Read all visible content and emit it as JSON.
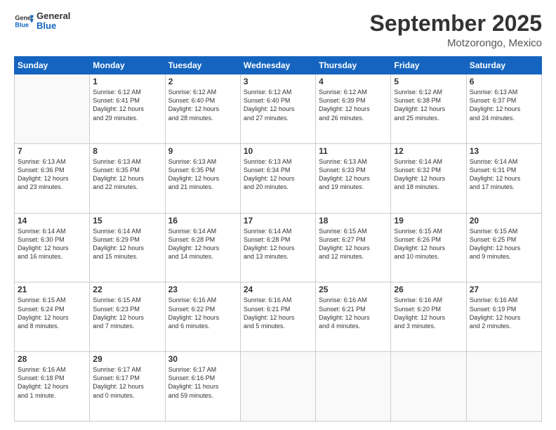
{
  "header": {
    "logo_general": "General",
    "logo_blue": "Blue",
    "month_title": "September 2025",
    "location": "Motzorongo, Mexico"
  },
  "days_of_week": [
    "Sunday",
    "Monday",
    "Tuesday",
    "Wednesday",
    "Thursday",
    "Friday",
    "Saturday"
  ],
  "weeks": [
    [
      {
        "day": "",
        "info": ""
      },
      {
        "day": "1",
        "info": "Sunrise: 6:12 AM\nSunset: 6:41 PM\nDaylight: 12 hours\nand 29 minutes."
      },
      {
        "day": "2",
        "info": "Sunrise: 6:12 AM\nSunset: 6:40 PM\nDaylight: 12 hours\nand 28 minutes."
      },
      {
        "day": "3",
        "info": "Sunrise: 6:12 AM\nSunset: 6:40 PM\nDaylight: 12 hours\nand 27 minutes."
      },
      {
        "day": "4",
        "info": "Sunrise: 6:12 AM\nSunset: 6:39 PM\nDaylight: 12 hours\nand 26 minutes."
      },
      {
        "day": "5",
        "info": "Sunrise: 6:12 AM\nSunset: 6:38 PM\nDaylight: 12 hours\nand 25 minutes."
      },
      {
        "day": "6",
        "info": "Sunrise: 6:13 AM\nSunset: 6:37 PM\nDaylight: 12 hours\nand 24 minutes."
      }
    ],
    [
      {
        "day": "7",
        "info": "Sunrise: 6:13 AM\nSunset: 6:36 PM\nDaylight: 12 hours\nand 23 minutes."
      },
      {
        "day": "8",
        "info": "Sunrise: 6:13 AM\nSunset: 6:35 PM\nDaylight: 12 hours\nand 22 minutes."
      },
      {
        "day": "9",
        "info": "Sunrise: 6:13 AM\nSunset: 6:35 PM\nDaylight: 12 hours\nand 21 minutes."
      },
      {
        "day": "10",
        "info": "Sunrise: 6:13 AM\nSunset: 6:34 PM\nDaylight: 12 hours\nand 20 minutes."
      },
      {
        "day": "11",
        "info": "Sunrise: 6:13 AM\nSunset: 6:33 PM\nDaylight: 12 hours\nand 19 minutes."
      },
      {
        "day": "12",
        "info": "Sunrise: 6:14 AM\nSunset: 6:32 PM\nDaylight: 12 hours\nand 18 minutes."
      },
      {
        "day": "13",
        "info": "Sunrise: 6:14 AM\nSunset: 6:31 PM\nDaylight: 12 hours\nand 17 minutes."
      }
    ],
    [
      {
        "day": "14",
        "info": "Sunrise: 6:14 AM\nSunset: 6:30 PM\nDaylight: 12 hours\nand 16 minutes."
      },
      {
        "day": "15",
        "info": "Sunrise: 6:14 AM\nSunset: 6:29 PM\nDaylight: 12 hours\nand 15 minutes."
      },
      {
        "day": "16",
        "info": "Sunrise: 6:14 AM\nSunset: 6:28 PM\nDaylight: 12 hours\nand 14 minutes."
      },
      {
        "day": "17",
        "info": "Sunrise: 6:14 AM\nSunset: 6:28 PM\nDaylight: 12 hours\nand 13 minutes."
      },
      {
        "day": "18",
        "info": "Sunrise: 6:15 AM\nSunset: 6:27 PM\nDaylight: 12 hours\nand 12 minutes."
      },
      {
        "day": "19",
        "info": "Sunrise: 6:15 AM\nSunset: 6:26 PM\nDaylight: 12 hours\nand 10 minutes."
      },
      {
        "day": "20",
        "info": "Sunrise: 6:15 AM\nSunset: 6:25 PM\nDaylight: 12 hours\nand 9 minutes."
      }
    ],
    [
      {
        "day": "21",
        "info": "Sunrise: 6:15 AM\nSunset: 6:24 PM\nDaylight: 12 hours\nand 8 minutes."
      },
      {
        "day": "22",
        "info": "Sunrise: 6:15 AM\nSunset: 6:23 PM\nDaylight: 12 hours\nand 7 minutes."
      },
      {
        "day": "23",
        "info": "Sunrise: 6:16 AM\nSunset: 6:22 PM\nDaylight: 12 hours\nand 6 minutes."
      },
      {
        "day": "24",
        "info": "Sunrise: 6:16 AM\nSunset: 6:21 PM\nDaylight: 12 hours\nand 5 minutes."
      },
      {
        "day": "25",
        "info": "Sunrise: 6:16 AM\nSunset: 6:21 PM\nDaylight: 12 hours\nand 4 minutes."
      },
      {
        "day": "26",
        "info": "Sunrise: 6:16 AM\nSunset: 6:20 PM\nDaylight: 12 hours\nand 3 minutes."
      },
      {
        "day": "27",
        "info": "Sunrise: 6:16 AM\nSunset: 6:19 PM\nDaylight: 12 hours\nand 2 minutes."
      }
    ],
    [
      {
        "day": "28",
        "info": "Sunrise: 6:16 AM\nSunset: 6:18 PM\nDaylight: 12 hours\nand 1 minute."
      },
      {
        "day": "29",
        "info": "Sunrise: 6:17 AM\nSunset: 6:17 PM\nDaylight: 12 hours\nand 0 minutes."
      },
      {
        "day": "30",
        "info": "Sunrise: 6:17 AM\nSunset: 6:16 PM\nDaylight: 11 hours\nand 59 minutes."
      },
      {
        "day": "",
        "info": ""
      },
      {
        "day": "",
        "info": ""
      },
      {
        "day": "",
        "info": ""
      },
      {
        "day": "",
        "info": ""
      }
    ]
  ]
}
